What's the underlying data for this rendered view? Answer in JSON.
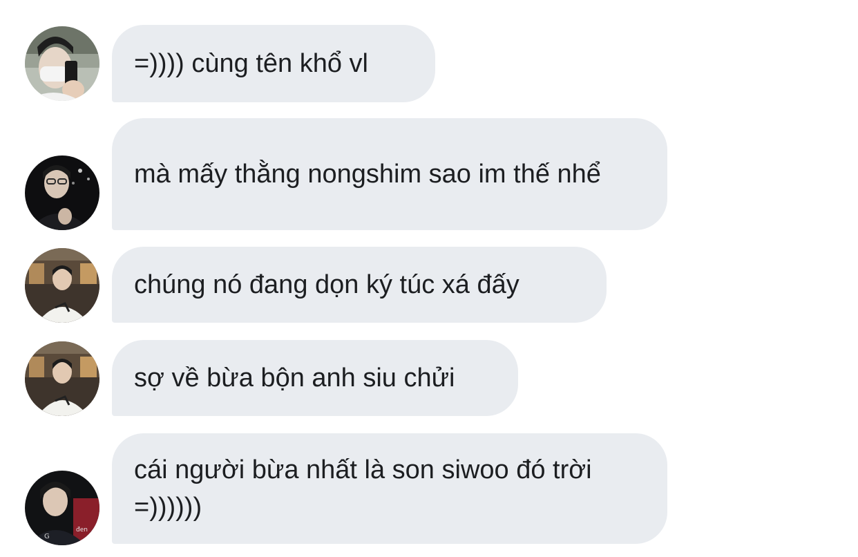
{
  "messages": [
    {
      "sender_avatar": "avatar-masked-selfie",
      "text": "=)))) cùng tên khổ vl"
    },
    {
      "sender_avatar": "avatar-dark-portrait",
      "text": "mà mấy thằng nongshim sao im thế nhể"
    },
    {
      "sender_avatar": "avatar-cafe-white-shirt",
      "text": "chúng nó đang dọn ký túc xá đấy"
    },
    {
      "sender_avatar": "avatar-cafe-white-shirt",
      "text": "sợ về bừa bộn anh siu chửi"
    },
    {
      "sender_avatar": "avatar-jersey-portrait",
      "text": "cái người bừa nhất là son siwoo đó trời =))))))"
    }
  ],
  "colors": {
    "bubble_bg": "#e9ecf0",
    "text": "#1c1e21",
    "page_bg": "#ffffff"
  }
}
